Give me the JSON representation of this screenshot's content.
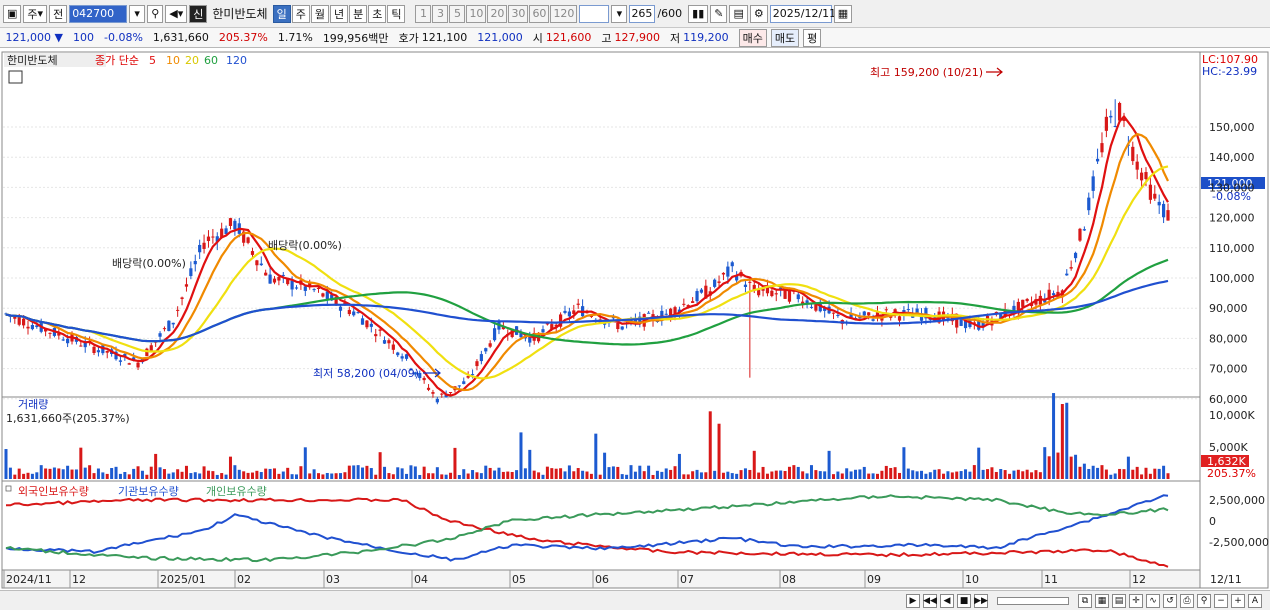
{
  "toolbar": {
    "period_type": "주",
    "period_prev": "전",
    "code": "042700",
    "badge": "신",
    "stock_name": "한미반도체",
    "tabs": [
      "일",
      "주",
      "월",
      "년",
      "분",
      "초",
      "틱"
    ],
    "active_tab": "일",
    "nums": [
      "1",
      "3",
      "5",
      "10",
      "20",
      "30",
      "60",
      "120"
    ],
    "count": "265",
    "count_total": "/600",
    "date": "2025/12/11"
  },
  "quote": {
    "price": "121,000",
    "change": "100",
    "change_pct": "-0.08%",
    "volume": "1,631,660",
    "volume_ratio": "205.37%",
    "turnover": "1.71%",
    "amount": "199,956백만",
    "ask_label": "호가",
    "ask": "121,100",
    "bid": "121,000",
    "open_label": "시",
    "open": "121,600",
    "high_label": "고",
    "high": "127,900",
    "low_label": "저",
    "low": "119,200",
    "buy_label": "매수",
    "sell_label": "매도",
    "eval_label": "평"
  },
  "price_panel": {
    "name": "한미반도체",
    "ma_label": "종가 단순",
    "ma_periods": [
      "5",
      "10",
      "20",
      "60",
      "120"
    ],
    "lc": "LC:107.90",
    "hc": "HC:-23.99",
    "high_annot": "최고 159,200 (10/21)",
    "low_annot": "최저 58,200 (04/09)",
    "div_annot_1": "배당락(0.00%)",
    "div_annot_2": "배당락(0.00%)",
    "current_price_tag": "121,000",
    "current_pct_tag": "-0.08%",
    "y_ticks": [
      "150,000",
      "140,000",
      "130,000",
      "120,000",
      "110,000",
      "100,000",
      "90,000",
      "80,000",
      "70,000",
      "60,000"
    ]
  },
  "volume_panel": {
    "title": "거래량",
    "value": "1,631,660주(205.37%)",
    "y_ticks": [
      "10,000K",
      "5,000K"
    ],
    "tag_value": "1,632K",
    "tag_pct": "205.37%"
  },
  "holder_panel": {
    "legend": [
      "외국인보유수량",
      "기관보유수량",
      "개인보유수량"
    ],
    "y_ticks": [
      "2,500,000",
      "0",
      "-2,500,000"
    ]
  },
  "x_labels": [
    "2024/11",
    "12",
    "2025/01",
    "02",
    "03",
    "04",
    "05",
    "06",
    "07",
    "08",
    "09",
    "10",
    "11",
    "12",
    "12/11"
  ],
  "colors": {
    "up": "#d81818",
    "down": "#1c5ad0",
    "ma5": "#e01010",
    "ma10": "#f08a00",
    "ma20": "#f0e010",
    "ma60": "#20a040",
    "ma120": "#2050d0",
    "foreign": "#d81818",
    "institution": "#2050d0",
    "individual": "#3a9a5a"
  },
  "chart_data": {
    "type": "candlestick",
    "note_unit": "KRW",
    "ylim": [
      55000,
      162000
    ],
    "key_points": [
      {
        "date": "2024/11",
        "close": 88000
      },
      {
        "date": "2024/12",
        "close": 72000
      },
      {
        "date": "2025/01",
        "close": 115000
      },
      {
        "date": "2025/02",
        "close": 105000
      },
      {
        "date": "2025/03",
        "close": 88000
      },
      {
        "date": "2025/04/09",
        "low": 58200
      },
      {
        "date": "2025/05",
        "close": 82000
      },
      {
        "date": "2025/06",
        "close": 86000
      },
      {
        "date": "2025/07",
        "close": 100000
      },
      {
        "date": "2025/08",
        "close": 87000
      },
      {
        "date": "2025/09",
        "close": 84000
      },
      {
        "date": "2025/10/21",
        "high": 159200
      },
      {
        "date": "2025/11",
        "close": 128000
      },
      {
        "date": "2025/12/11",
        "open": 121600,
        "high": 127900,
        "low": 119200,
        "close": 121000
      }
    ]
  }
}
